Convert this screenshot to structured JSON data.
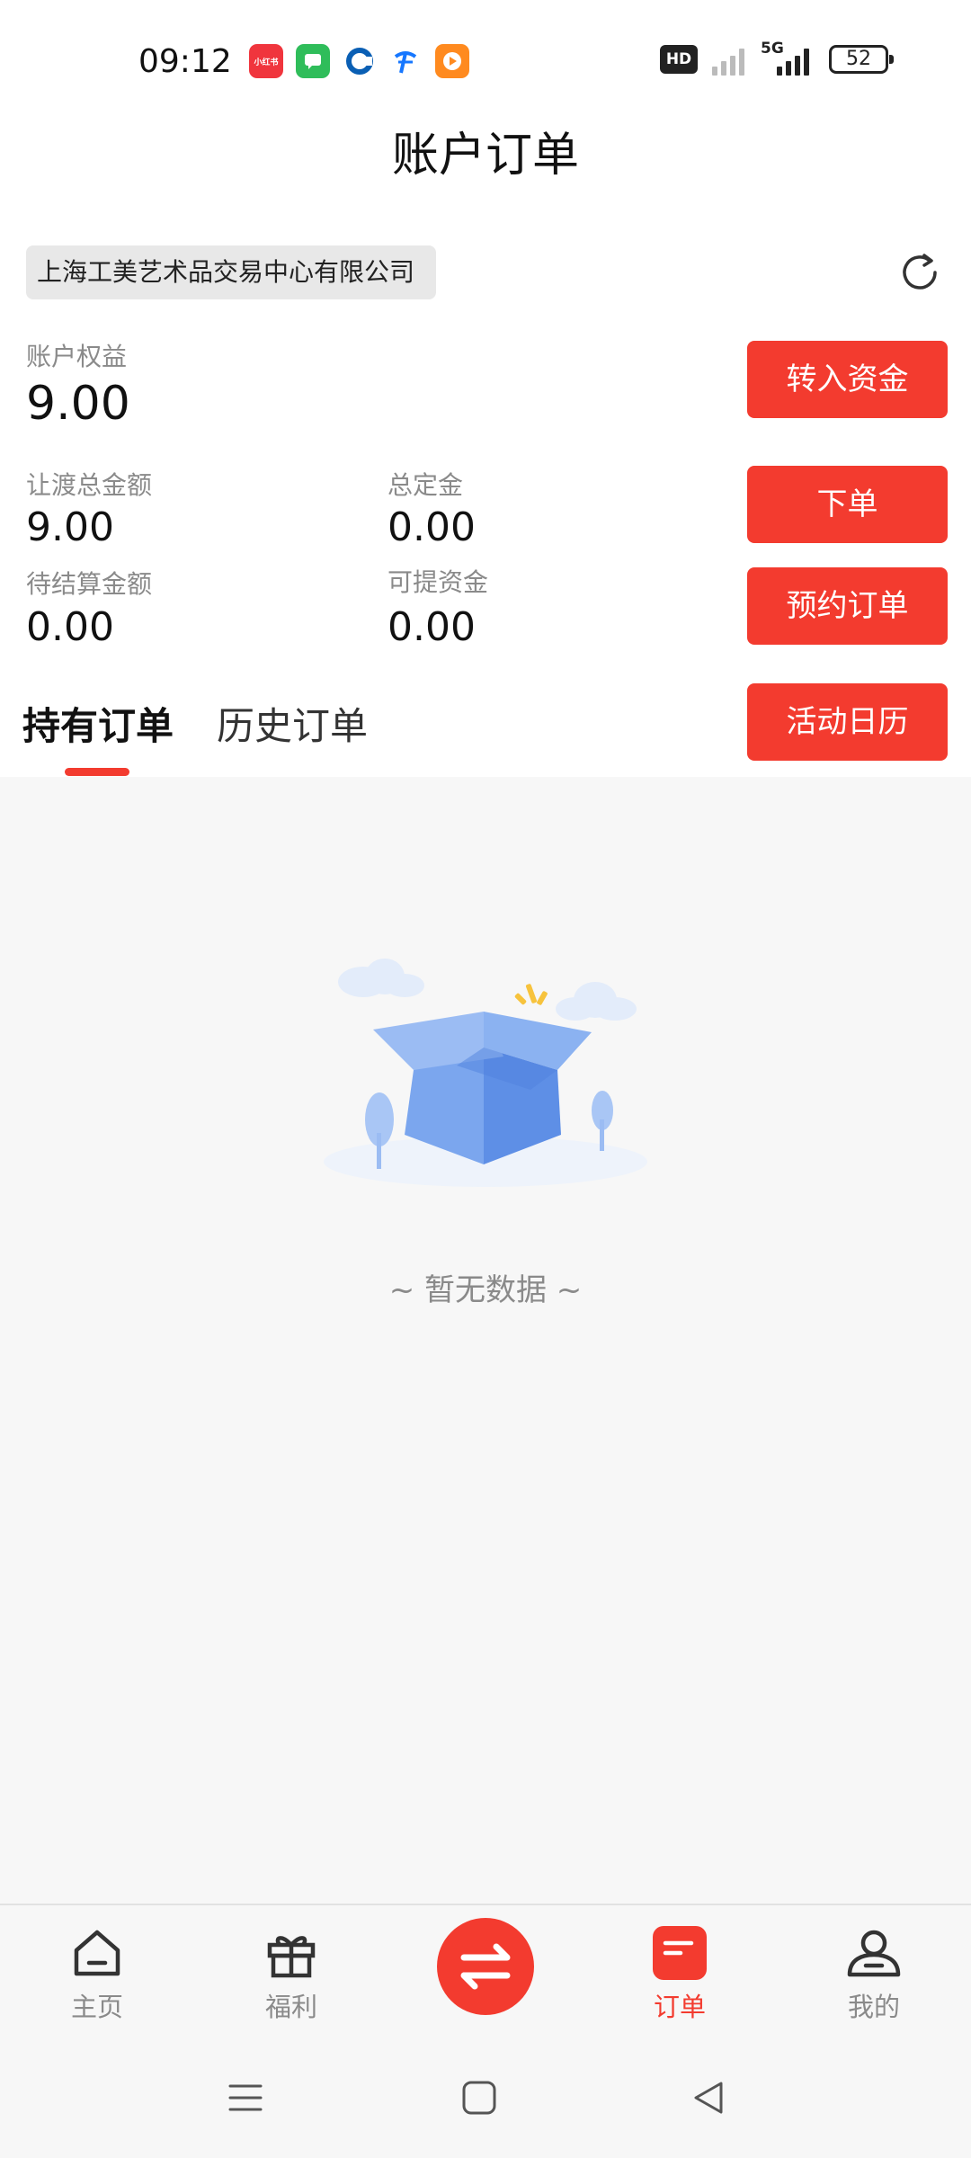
{
  "status_bar": {
    "time": "09:12",
    "apps": [
      {
        "name": "xiaohongshu-icon",
        "label": "小红书",
        "color": "#f0353d"
      },
      {
        "name": "message-icon",
        "label": "",
        "color": "#2fbd5a"
      },
      {
        "name": "bank-app-icon",
        "label": "",
        "color": "#0a5fb4"
      },
      {
        "name": "telecom-icon",
        "label": "",
        "color": "#1677ff"
      },
      {
        "name": "video-app-icon",
        "label": "",
        "color": "#ff8a1f"
      }
    ],
    "hd_label": "HD",
    "network_label": "5G",
    "battery": "52"
  },
  "header": {
    "title": "账户订单"
  },
  "company": {
    "name": "上海工美艺术品交易中心有限公司"
  },
  "account": {
    "equity_label": "账户权益",
    "equity_value": "9.00",
    "transfer_total_label": "让渡总金额",
    "transfer_total_value": "9.00",
    "total_deposit_label": "总定金",
    "total_deposit_value": "0.00",
    "pending_label": "待结算金额",
    "pending_value": "0.00",
    "withdrawable_label": "可提资金",
    "withdrawable_value": "0.00"
  },
  "actions": {
    "deposit": "转入资金",
    "order": "下单",
    "reserve": "预约订单",
    "calendar": "活动日历"
  },
  "tabs": {
    "holding": "持有订单",
    "history": "历史订单"
  },
  "empty": {
    "text": "~ 暂无数据 ~"
  },
  "bottom_nav": {
    "home": "主页",
    "benefits": "福利",
    "orders": "订单",
    "mine": "我的"
  },
  "colors": {
    "accent": "#f33b2f",
    "muted": "#8a8a8a"
  }
}
